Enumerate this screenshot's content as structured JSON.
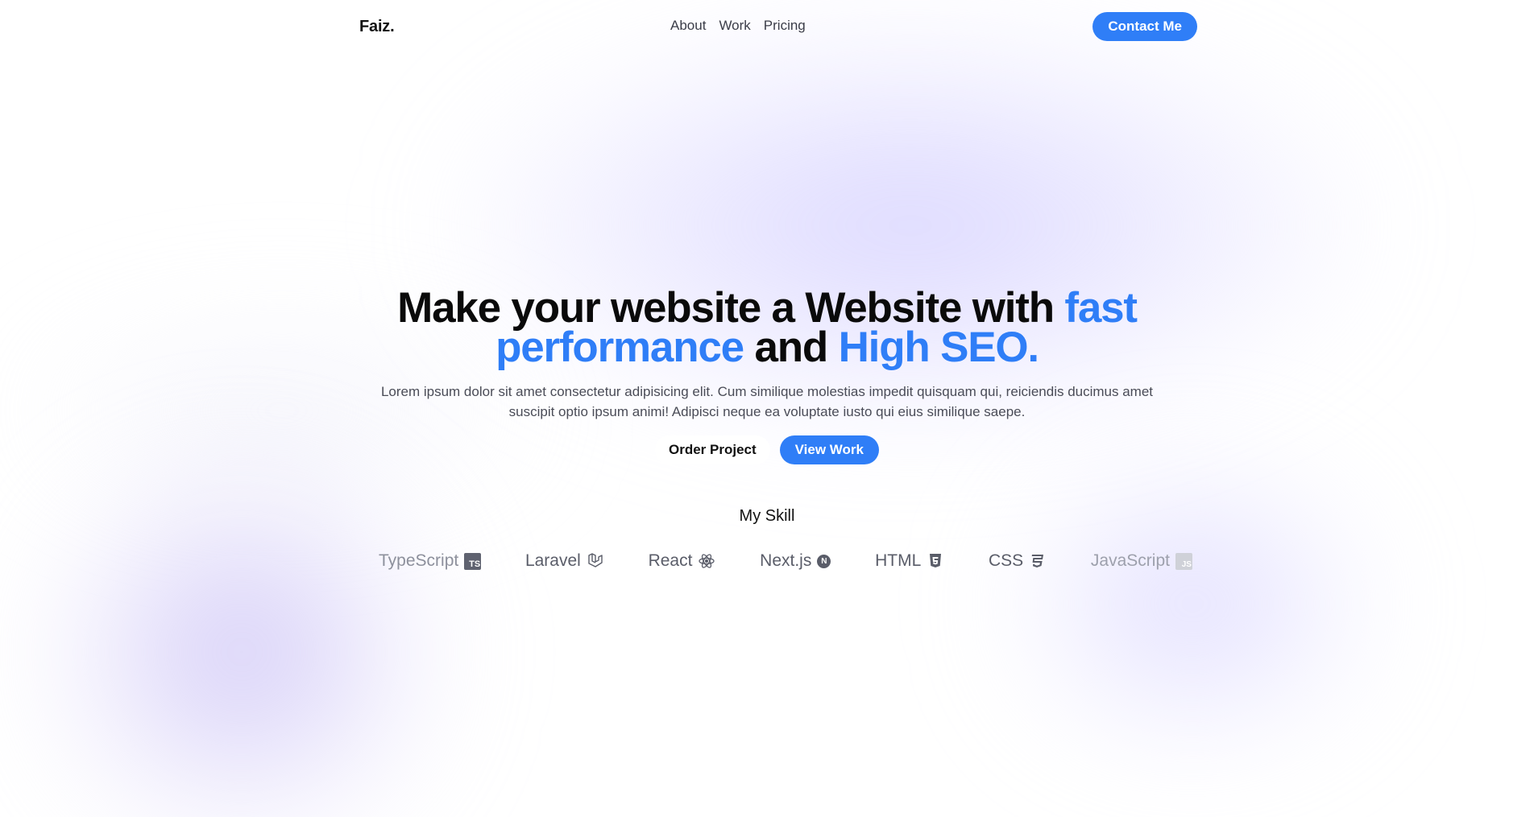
{
  "brand": {
    "logo": "Faiz."
  },
  "nav": {
    "links": [
      "About",
      "Work",
      "Pricing"
    ],
    "cta_label": "Contact Me"
  },
  "hero": {
    "headline_part1": "Make your website a Website with ",
    "headline_accent1": "fast performance",
    "headline_part2": " and ",
    "headline_accent2": "High SEO.",
    "subtext": "Lorem ipsum dolor sit amet consectetur adipisicing elit. Cum similique molestias impedit quisquam qui, reiciendis ducimus amet suscipit optio ipsum animi! Adipisci neque ea voluptate iusto qui eius similique saepe.",
    "order_label": "Order Project",
    "view_label": "View Work"
  },
  "skills": {
    "title": "My Skill",
    "items": [
      {
        "label": "TypeScript",
        "icon": "typescript-icon"
      },
      {
        "label": "Laravel",
        "icon": "laravel-icon"
      },
      {
        "label": "React",
        "icon": "react-icon"
      },
      {
        "label": "Next.js",
        "icon": "nextjs-icon"
      },
      {
        "label": "HTML",
        "icon": "html5-icon"
      },
      {
        "label": "CSS",
        "icon": "css3-icon"
      },
      {
        "label": "JavaScript",
        "icon": "javascript-icon"
      }
    ]
  },
  "colors": {
    "accent": "#2f7ef7",
    "text_dark": "#0a0a0a",
    "text_muted": "#4a4c57",
    "blob_purple": "#d4ccff"
  }
}
